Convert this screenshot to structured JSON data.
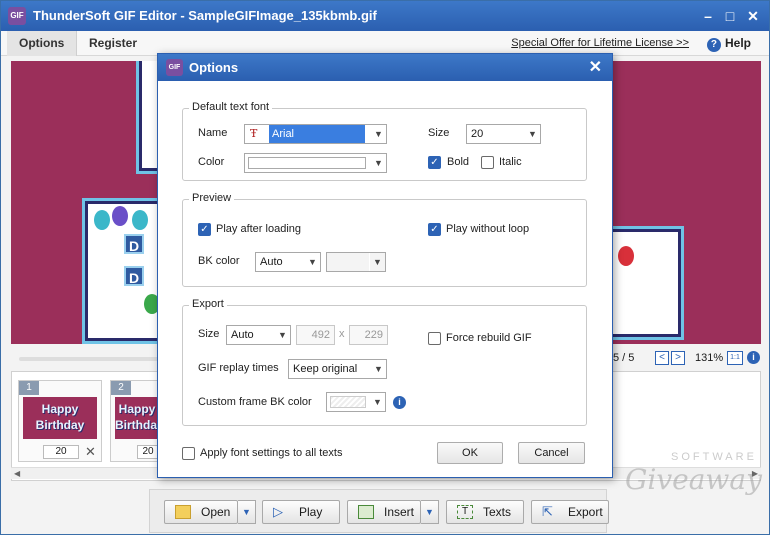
{
  "app": {
    "title": "ThunderSoft GIF Editor - SampleGIFImage_135kbmb.gif",
    "icon_text": "GIF"
  },
  "menubar": {
    "tabs": [
      "Options",
      "Register"
    ],
    "offer_link": "Special Offer for Lifetime License >>",
    "help_label": "Help"
  },
  "canvas": {
    "background_color": "#9b2f5a"
  },
  "status": {
    "frame_counter": "5 / 5",
    "zoom_level": "131%",
    "zoom_chip": "1:1"
  },
  "filmstrip": {
    "frames": [
      {
        "number": "1",
        "caption": "Happy Birthday",
        "delay": "20"
      },
      {
        "number": "2",
        "caption": "Happy Birthday",
        "delay": "20"
      }
    ]
  },
  "toolbar": {
    "open_label": "Open",
    "play_label": "Play",
    "insert_label": "Insert",
    "texts_label": "Texts",
    "export_label": "Export"
  },
  "watermark": {
    "line1": "SOFTWARE",
    "line2": "Giveaway"
  },
  "dialog": {
    "title": "Options",
    "font_group": {
      "title": "Default text font",
      "name_label": "Name",
      "name_value": "Arial",
      "size_label": "Size",
      "size_value": "20",
      "color_label": "Color",
      "bold_label": "Bold",
      "bold_checked": true,
      "italic_label": "Italic",
      "italic_checked": false
    },
    "preview_group": {
      "title": "Preview",
      "play_after_loading_label": "Play after loading",
      "play_after_loading_checked": true,
      "play_without_loop_label": "Play without loop",
      "play_without_loop_checked": true,
      "bk_color_label": "BK color",
      "bk_color_value": "Auto"
    },
    "export_group": {
      "title": "Export",
      "size_label": "Size",
      "size_value": "Auto",
      "width_value": "492",
      "times_sign": "x",
      "height_value": "229",
      "force_rebuild_label": "Force rebuild GIF",
      "force_rebuild_checked": false,
      "replay_label": "GIF replay times",
      "replay_value": "Keep original",
      "custom_bk_label": "Custom frame BK color"
    },
    "apply_all_label": "Apply font settings to all texts",
    "apply_all_checked": false,
    "ok_label": "OK",
    "cancel_label": "Cancel"
  },
  "colors": {
    "accent": "#2d63b5",
    "titlebar": "#2b5fb0",
    "selection": "#3a7ee0"
  }
}
